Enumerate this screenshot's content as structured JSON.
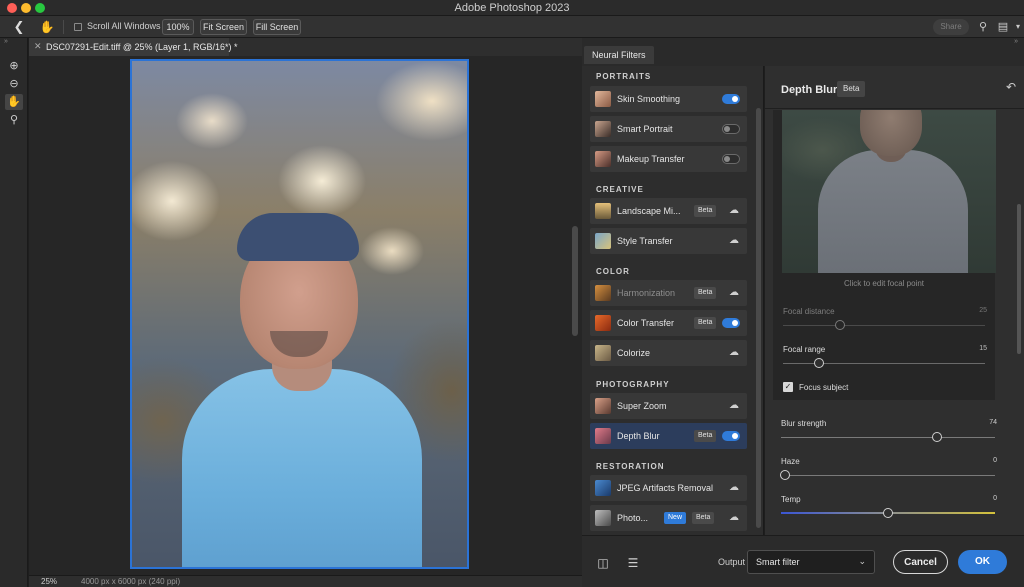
{
  "app": {
    "title": "Adobe Photoshop 2023"
  },
  "options_bar": {
    "scroll_all_windows": "Scroll All Windows",
    "zoom_100": "100%",
    "fit_screen": "Fit Screen",
    "fill_screen": "Fill Screen",
    "share": "Share"
  },
  "document": {
    "tab_label": "DSC07291-Edit.tiff @ 25% (Layer 1, RGB/16*) *",
    "zoom": "25%",
    "dimensions": "4000 px x 6000 px (240 ppi)"
  },
  "neural_filters": {
    "panel_tab": "Neural Filters",
    "sections": [
      {
        "title": "PORTRAITS"
      },
      {
        "title": "CREATIVE"
      },
      {
        "title": "COLOR"
      },
      {
        "title": "PHOTOGRAPHY"
      },
      {
        "title": "RESTORATION"
      }
    ],
    "filters": [
      {
        "name": "Skin Smoothing",
        "state": "on"
      },
      {
        "name": "Smart Portrait",
        "state": "off"
      },
      {
        "name": "Makeup Transfer",
        "state": "off"
      },
      {
        "name": "Landscape Mi...",
        "badge": "Beta",
        "state": "cloud"
      },
      {
        "name": "Style Transfer",
        "state": "cloud"
      },
      {
        "name": "Harmonization",
        "badge": "Beta",
        "state": "cloud"
      },
      {
        "name": "Color Transfer",
        "badge": "Beta",
        "state": "on"
      },
      {
        "name": "Colorize",
        "state": "cloud"
      },
      {
        "name": "Super Zoom",
        "state": "cloud"
      },
      {
        "name": "Depth Blur",
        "badge": "Beta",
        "state": "on"
      },
      {
        "name": "JPEG Artifacts Removal",
        "state": "cloud"
      },
      {
        "name": "Photo...",
        "badge_new": "New",
        "badge": "Beta",
        "state": "cloud"
      }
    ]
  },
  "depth_blur": {
    "title": "Depth Blur",
    "badge": "Beta",
    "preview_caption": "Click to edit focal point",
    "focal_distance": {
      "label": "Focal distance",
      "value": 25
    },
    "focal_range": {
      "label": "Focal range",
      "value": 15
    },
    "focus_subject": {
      "label": "Focus subject",
      "checked": true
    },
    "blur_strength": {
      "label": "Blur strength",
      "value": 74
    },
    "haze": {
      "label": "Haze",
      "value": 0
    },
    "temp": {
      "label": "Temp",
      "value": 0
    }
  },
  "footer": {
    "output_label": "Output",
    "output_value": "Smart filter",
    "cancel": "Cancel",
    "ok": "OK"
  }
}
